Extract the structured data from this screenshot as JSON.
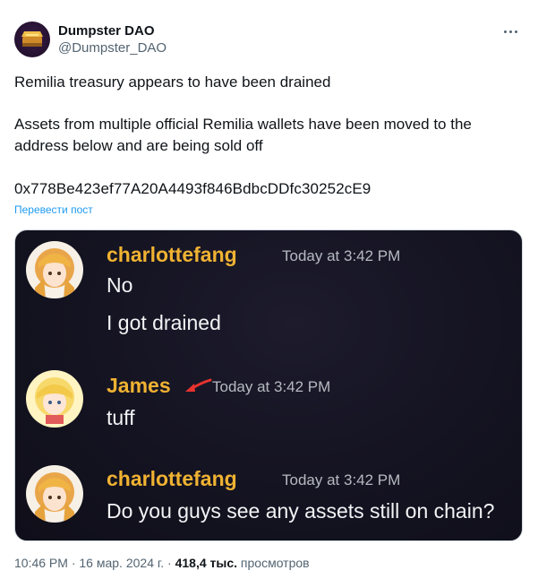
{
  "author": {
    "name": "Dumpster DAO",
    "handle": "@Dumpster_DAO"
  },
  "tweet": {
    "line1": "Remilia treasury appears to have been drained",
    "line2": "Assets from multiple official Remilia wallets have been moved to the address below and are being sold off",
    "address": "0x778Be423ef77A20A4493f846BdbcDDfc30252cE9",
    "translate_label": "Перевести пост"
  },
  "media": {
    "messages": [
      {
        "user": "charlottefang",
        "time": "Today at 3:42 PM",
        "lines": [
          "No",
          "I got drained"
        ]
      },
      {
        "user": "James",
        "time": "Today at 3:42 PM",
        "lines": [
          "tuff"
        ]
      },
      {
        "user": "charlottefang",
        "time": "Today at 3:42 PM",
        "lines": [
          "Do you guys see any assets still on chain?"
        ]
      }
    ]
  },
  "footer": {
    "time": "10:46 PM",
    "date": "16 мар. 2024 г.",
    "views_count": "418,4 тыс.",
    "views_label": "просмотров"
  },
  "colors": {
    "discord_username": "#f0b232",
    "discord_bg": "#141321",
    "link": "#1d9bf0"
  },
  "icons": [
    "more-icon",
    "arrow-icon",
    "dumpster-avatar"
  ]
}
